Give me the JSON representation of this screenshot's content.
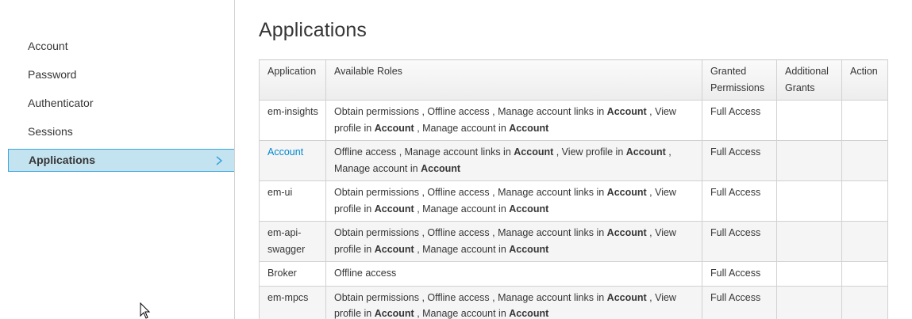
{
  "sidebar": {
    "items": [
      {
        "label": "Account"
      },
      {
        "label": "Password"
      },
      {
        "label": "Authenticator"
      },
      {
        "label": "Sessions"
      },
      {
        "label": "Applications",
        "active": true
      }
    ]
  },
  "main": {
    "title": "Applications",
    "table": {
      "headers": {
        "application": "Application",
        "roles": "Available Roles",
        "granted": "Granted Permissions",
        "additional": "Additional Grants",
        "action": "Action"
      },
      "rows": [
        {
          "app": "em-insights",
          "app_is_link": false,
          "roles": [
            [
              "Obtain permissions , Offline access , Manage account links in ",
              false
            ],
            [
              "Account",
              true
            ],
            [
              " , View profile in ",
              false
            ],
            [
              "Account",
              true
            ],
            [
              " , Manage account in ",
              false
            ],
            [
              "Account",
              true
            ]
          ],
          "granted": "Full Access",
          "additional": "",
          "action": ""
        },
        {
          "app": "Account",
          "app_is_link": true,
          "roles": [
            [
              "Offline access , Manage account links in ",
              false
            ],
            [
              "Account",
              true
            ],
            [
              " , View profile in ",
              false
            ],
            [
              "Account",
              true
            ],
            [
              " , Manage account in ",
              false
            ],
            [
              "Account",
              true
            ]
          ],
          "granted": "Full Access",
          "additional": "",
          "action": ""
        },
        {
          "app": "em-ui",
          "app_is_link": false,
          "roles": [
            [
              "Obtain permissions , Offline access , Manage account links in ",
              false
            ],
            [
              "Account",
              true
            ],
            [
              " , View profile in ",
              false
            ],
            [
              "Account",
              true
            ],
            [
              " , Manage account in ",
              false
            ],
            [
              "Account",
              true
            ]
          ],
          "granted": "Full Access",
          "additional": "",
          "action": ""
        },
        {
          "app": "em-api-swagger",
          "app_is_link": false,
          "roles": [
            [
              "Obtain permissions , Offline access , Manage account links in ",
              false
            ],
            [
              "Account",
              true
            ],
            [
              " , View profile in ",
              false
            ],
            [
              "Account",
              true
            ],
            [
              " , Manage account in ",
              false
            ],
            [
              "Account",
              true
            ]
          ],
          "granted": "Full Access",
          "additional": "",
          "action": ""
        },
        {
          "app": "Broker",
          "app_is_link": false,
          "roles": [
            [
              "Offline access",
              false
            ]
          ],
          "granted": "Full Access",
          "additional": "",
          "action": ""
        },
        {
          "app": "em-mpcs",
          "app_is_link": false,
          "roles": [
            [
              "Obtain permissions , Offline access , Manage account links in ",
              false
            ],
            [
              "Account",
              true
            ],
            [
              " , View profile in ",
              false
            ],
            [
              "Account",
              true
            ],
            [
              " , Manage account in ",
              false
            ],
            [
              "Account",
              true
            ]
          ],
          "granted": "Full Access",
          "additional": "",
          "action": ""
        }
      ]
    }
  },
  "colors": {
    "active_bg": "#c4e3f0",
    "active_border": "#39a5dc",
    "link": "#0088ce",
    "border": "#d1d1d1"
  },
  "icons": {
    "active_chevron": "chevron-right-icon",
    "mouse_cursor": "mouse-pointer-icon"
  }
}
